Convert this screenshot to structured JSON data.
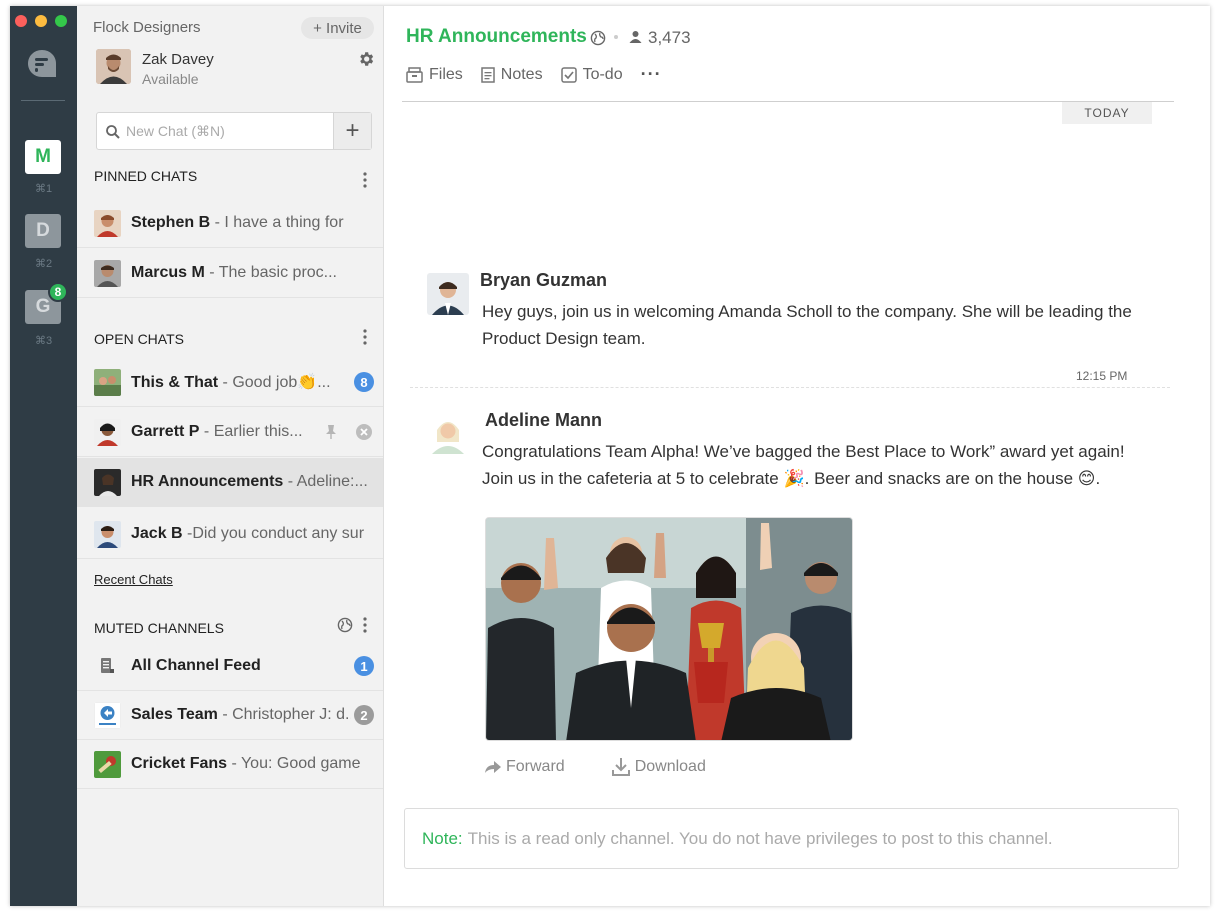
{
  "window": {
    "team_rail": {
      "teams": [
        {
          "initial": "M",
          "shortcut": "⌘1",
          "active": true
        },
        {
          "initial": "D",
          "shortcut": "⌘2",
          "active": false
        },
        {
          "initial": "G",
          "shortcut": "⌘3",
          "active": false,
          "badge": "8"
        }
      ]
    }
  },
  "sidebar": {
    "team_name": "Flock Designers",
    "invite_label": "+ Invite",
    "user": {
      "name": "Zak Davey",
      "status": "Available"
    },
    "search": {
      "placeholder": "New Chat (⌘N)",
      "add_label": "+"
    },
    "pinned": {
      "title": "PINNED CHATS",
      "items": [
        {
          "name": "Stephen B",
          "preview": " - I have a thing for"
        },
        {
          "name": "Marcus M",
          "preview": " - The basic proc..."
        }
      ]
    },
    "open": {
      "title": "OPEN CHATS",
      "items": [
        {
          "name": "This & That",
          "preview": " - Good job👏...",
          "badge": "8"
        },
        {
          "name": "Garrett P",
          "preview": " - Earlier this..."
        },
        {
          "name": "HR Announcements",
          "preview": " - Adeline:..."
        },
        {
          "name": "Jack B",
          "preview": " -Did you conduct any sur"
        }
      ]
    },
    "recent_link": "Recent Chats",
    "muted": {
      "title": "MUTED CHANNELS",
      "items": [
        {
          "name": "All Channel Feed",
          "preview": "",
          "badge": "1"
        },
        {
          "name": "Sales Team",
          "preview": " - Christopher J: d...",
          "badge": "2"
        },
        {
          "name": "Cricket Fans",
          "preview": " - You: Good game"
        }
      ]
    }
  },
  "main": {
    "channel_title": "HR Announcements",
    "member_count": "3,473",
    "tabs": {
      "files": "Files",
      "notes": "Notes",
      "todo": "To-do",
      "more": "···"
    },
    "date_divider": "TODAY",
    "messages": [
      {
        "author": "Bryan Guzman",
        "lines": [
          "Hey guys, join us in welcoming Amanda Scholl to the company. She will be leading the",
          "Product Design team."
        ]
      },
      {
        "time": "12:15 PM",
        "author": "Adeline Mann",
        "lines": [
          "Congratulations Team Alpha! We’ve bagged the Best Place to Work” award yet again!",
          "Join us in the cafeteria at 5 to celebrate 🎉. Beer and snacks are on the house 😊."
        ]
      }
    ],
    "attachment": {
      "forward_label": "Forward",
      "download_label": "Download"
    },
    "readonly": {
      "note_label": "Note:",
      "text": "This is a read only channel. You do not have privileges to post to this channel."
    }
  },
  "colors": {
    "brand_green": "#2fb55a",
    "rail_bg": "#2f3c45",
    "badge_blue": "#4a90e2",
    "badge_gray": "#9b9b9b"
  }
}
